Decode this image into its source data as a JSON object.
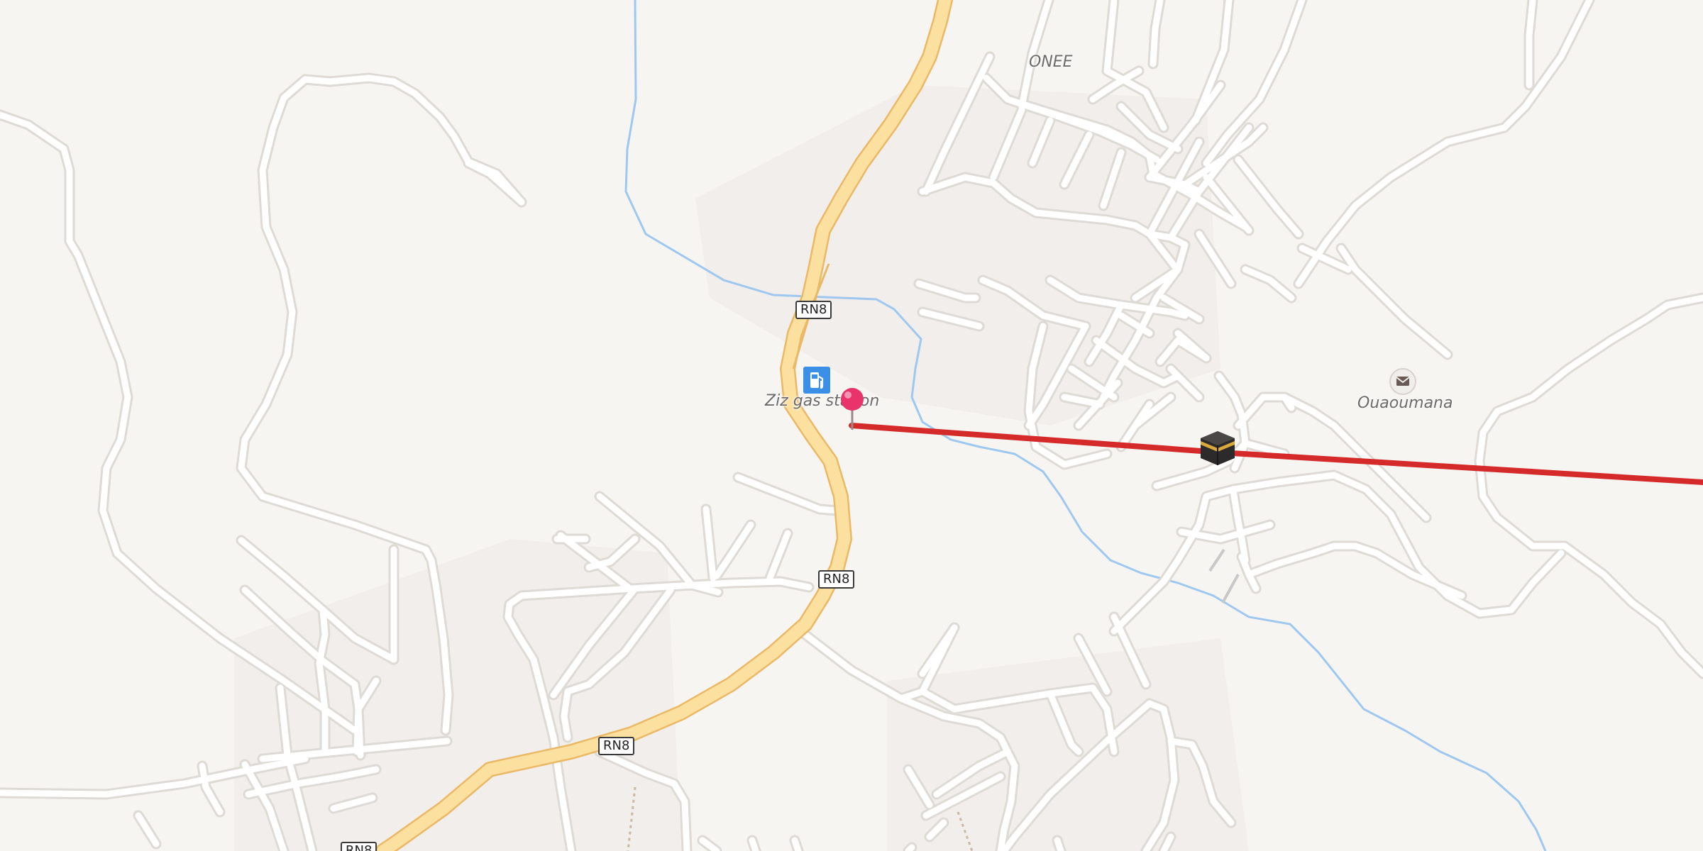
{
  "map": {
    "colors": {
      "background": "#f7f5f2",
      "road": "#ffffff",
      "road_casing": "#dedad5",
      "primary_road": "#fbe0a0",
      "primary_road_casing": "#ebb966",
      "river": "#9ec8ef",
      "route_line": "#d42a2a",
      "pin": "#e8336b"
    },
    "road_shields": [
      {
        "label": "RN8"
      },
      {
        "label": "RN8"
      },
      {
        "label": "RN8"
      },
      {
        "label": "RN8"
      }
    ],
    "labels": {
      "onee": "ONEE",
      "gas_station": "Ziz gas station",
      "post_office": "Ouaoumana"
    },
    "icons": {
      "gas_station": "fuel-pump-icon",
      "post_office": "envelope-icon",
      "landmark": "kaaba-icon",
      "pin": "map-pin-icon"
    }
  }
}
